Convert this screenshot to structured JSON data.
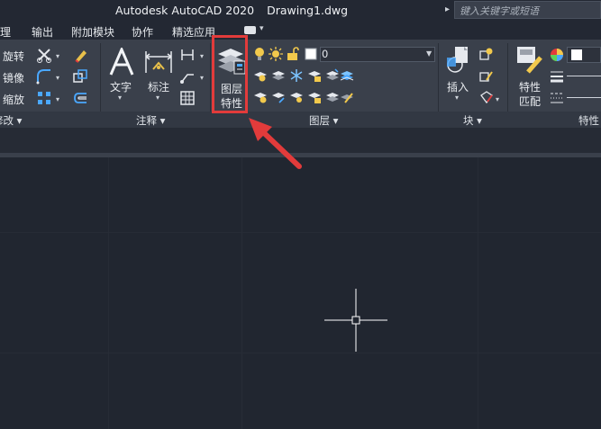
{
  "window": {
    "app_title": "Autodesk AutoCAD 2020",
    "document": "Drawing1.dwg"
  },
  "search": {
    "placeholder": "键入关键字或短语"
  },
  "menu": [
    "理",
    "输出",
    "附加模块",
    "协作",
    "精选应用"
  ],
  "ribbon": {
    "modify": {
      "rotate": "旋转",
      "mirror": "镜像",
      "scale": "缩放"
    },
    "annotation": {
      "text": "文字",
      "dimension": "标注"
    },
    "layers": {
      "properties_line1": "图层",
      "properties_line2": "特性",
      "current_layer": "0"
    },
    "block": {
      "insert": "插入"
    },
    "properties": {
      "match_line1": "特性",
      "match_line2": "匹配"
    }
  },
  "panels": {
    "modify": "修改",
    "annotation": "注释",
    "layers": "图层",
    "block": "块",
    "properties": "特性"
  },
  "colors": {
    "highlight": "#e23b3b",
    "ribbon_bg": "#3a404b",
    "canvas_bg": "#212630"
  }
}
